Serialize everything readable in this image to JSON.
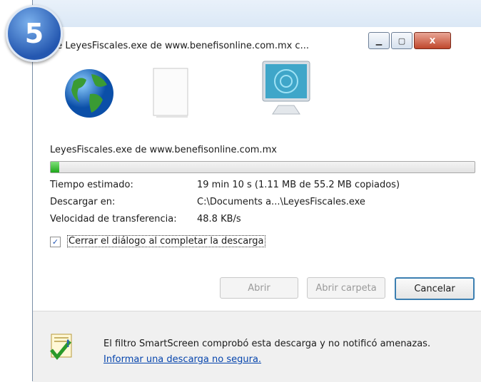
{
  "step_badge": "5",
  "window": {
    "title": "de LeyesFiscales.exe de www.benefisonline.com.mx c...",
    "minimize_glyph": "▁",
    "maximize_glyph": "▢",
    "close_glyph": "X"
  },
  "icons": [
    "globe-icon",
    "document-icon",
    "monitor-icon"
  ],
  "download": {
    "filename_line": "LeyesFiscales.exe de www.benefisonline.com.mx",
    "progress_fraction": 0.02,
    "rows": [
      {
        "label": "Tiempo estimado:",
        "value": "19 min 10 s (1.11 MB de 55.2 MB copiados)"
      },
      {
        "label": "Descargar en:",
        "value": "C:\\Documents a...\\LeyesFiscales.exe"
      },
      {
        "label": "Velocidad de transferencia:",
        "value": "48.8 KB/s"
      }
    ]
  },
  "checkbox": {
    "label": "Cerrar el diálogo al completar la descarga",
    "checked": true,
    "mark": "✓"
  },
  "buttons": {
    "open": "Abrir",
    "open_folder": "Abrir carpeta",
    "cancel": "Cancelar"
  },
  "footer": {
    "message": "El filtro SmartScreen comprobó esta descarga y no notificó amenazas.",
    "link": "Informar una descarga no segura."
  },
  "colors": {
    "accent": "#2457b0",
    "progress": "#1ea71a",
    "link": "#0645ad"
  }
}
